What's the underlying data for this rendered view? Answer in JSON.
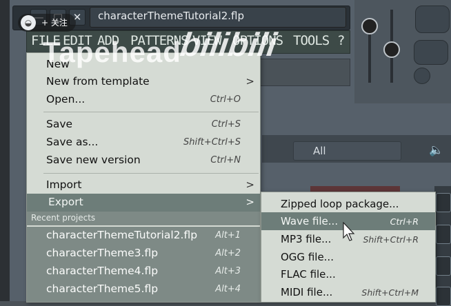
{
  "window": {
    "title": "characterThemeTutorial2.flp",
    "minimize_glyph": "—",
    "maximize_glyph": "□",
    "close_glyph": "✕"
  },
  "menubar": [
    "FILE",
    "EDIT",
    "ADD",
    "PATTERNS",
    "VIEW",
    "OPTIONS",
    "TOOLS",
    "?"
  ],
  "browser": {
    "filter_value": "All"
  },
  "watermark": {
    "follow_label": "+ 关注",
    "channel_name": "Tapehead",
    "site_logo_text": "bilibili"
  },
  "file_menu": {
    "items": [
      {
        "label": "New",
        "shortcut": ""
      },
      {
        "label": "New from template",
        "shortcut": "",
        "arrow": ">"
      },
      {
        "label": "Open...",
        "shortcut": "Ctrl+O"
      },
      {
        "label": "Save",
        "shortcut": "Ctrl+S"
      },
      {
        "label": "Save as...",
        "shortcut": "Shift+Ctrl+S"
      },
      {
        "label": "Save new version",
        "shortcut": "Ctrl+N"
      },
      {
        "label": "Import",
        "shortcut": "",
        "arrow": ">"
      },
      {
        "label": "Export",
        "shortcut": "",
        "arrow": ">"
      }
    ],
    "recent_header": "Recent projects",
    "recent": [
      {
        "label": "characterThemeTutorial2.flp",
        "shortcut": "Alt+1"
      },
      {
        "label": "characterTheme3.flp",
        "shortcut": "Alt+2"
      },
      {
        "label": "characterTheme4.flp",
        "shortcut": "Alt+3"
      },
      {
        "label": "characterTheme5.flp",
        "shortcut": "Alt+4"
      }
    ]
  },
  "export_submenu": {
    "items": [
      {
        "label": "Zipped loop package...",
        "shortcut": ""
      },
      {
        "label": "Wave file...",
        "shortcut": "Ctrl+R"
      },
      {
        "label": "MP3 file...",
        "shortcut": "Shift+Ctrl+R"
      },
      {
        "label": "OGG file...",
        "shortcut": ""
      },
      {
        "label": "FLAC file...",
        "shortcut": ""
      },
      {
        "label": "MIDI file...",
        "shortcut": "Shift+Ctrl+M"
      }
    ]
  },
  "colors": {
    "menu_bg": "#d5dbd4",
    "highlight": "#6d7d79",
    "recent_bg": "#7e8a86",
    "app_bg": "#56606a"
  }
}
